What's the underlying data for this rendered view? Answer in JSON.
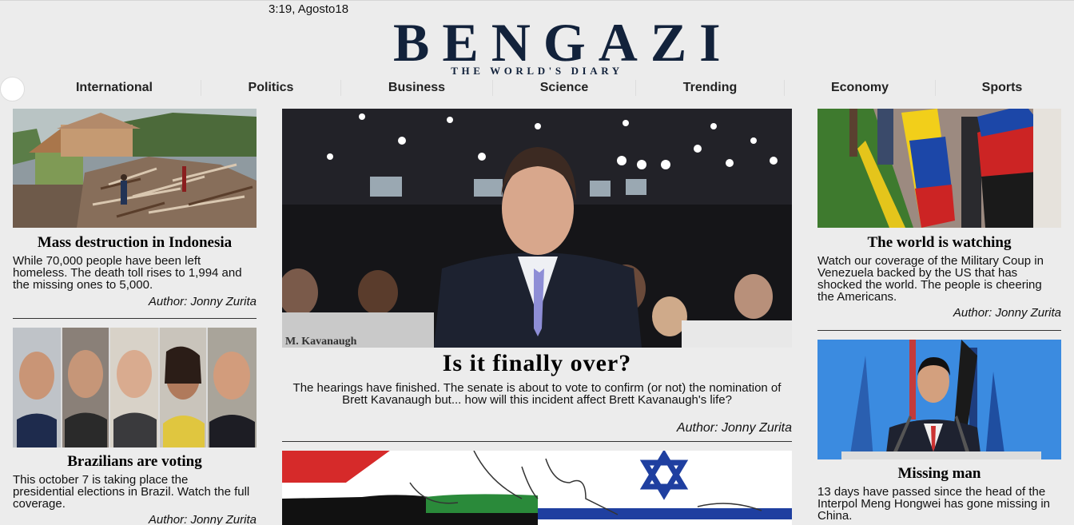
{
  "header": {
    "date": "3:19, Agosto18",
    "logo_title": "BENGAZI",
    "logo_subtitle": "THE WORLD'S DIARY"
  },
  "nav": {
    "items": [
      {
        "label": "International"
      },
      {
        "label": "Politics"
      },
      {
        "label": "Business"
      },
      {
        "label": "Science"
      },
      {
        "label": "Trending"
      },
      {
        "label": "Economy"
      },
      {
        "label": "Sports"
      }
    ]
  },
  "articles": {
    "indonesia": {
      "title": "Mass destruction in Indonesia",
      "body": "While 70,000 people have been left homeless. The death toll rises to 1,994 and the missing ones to 5,000.",
      "author": "Author: Jonny Zurita"
    },
    "brazil": {
      "title": "Brazilians are voting",
      "body": "This october 7 is taking place the presidential elections in Brazil. Watch the full coverage.",
      "author": "Author: Jonny Zurita"
    },
    "main": {
      "title": "Is it finally over?",
      "body": "The hearings have finished. The senate is about to vote to confirm (or not) the nomination of Brett Kavanaugh but... how will this incident affect Brett Kavanaugh's life?",
      "author": "Author: Jonny Zurita",
      "nameplate": "M. Kavanaugh"
    },
    "venezuela": {
      "title": "The world is watching",
      "body": "Watch our coverage of the Military Coup in Venezuela backed by the US that has shocked the world. The people is cheering the Americans.",
      "author": "Author: Jonny Zurita"
    },
    "missing": {
      "title": "Missing man",
      "body": "13 days have passed since the head of the Interpol Meng Hongwei has gone missing in China."
    }
  },
  "colors": {
    "background": "#ececec",
    "logo": "#12223b",
    "nav_text": "#222222",
    "divider": "#333333"
  }
}
